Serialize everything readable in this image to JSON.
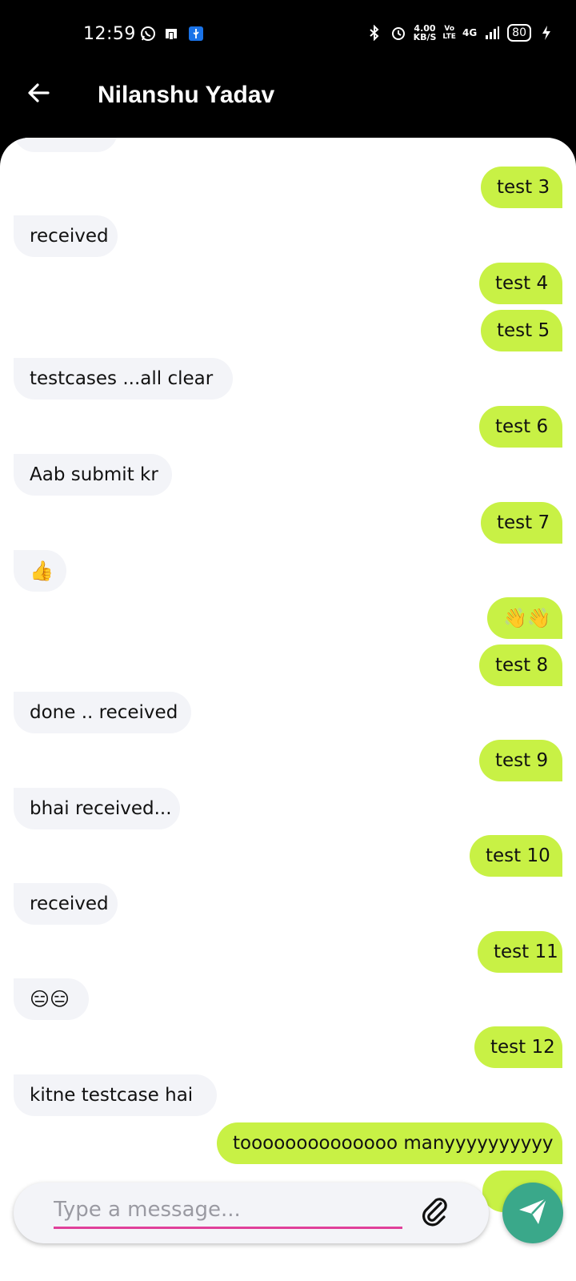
{
  "status": {
    "time": "12:59",
    "speed_value": "4.00",
    "speed_unit": "KB/S",
    "volte_top": "Vo",
    "volte_bottom": "LTE",
    "network": "4G",
    "battery": "80"
  },
  "header": {
    "title": "Nilanshu Yadav"
  },
  "messages": [
    {
      "dir": "out",
      "text": "test 3"
    },
    {
      "dir": "in",
      "text": "received"
    },
    {
      "dir": "out",
      "text": "test 4"
    },
    {
      "dir": "out",
      "text": "test 5"
    },
    {
      "dir": "in",
      "text": "testcases ...all clear"
    },
    {
      "dir": "out",
      "text": "test 6"
    },
    {
      "dir": "in",
      "text": "Aab submit kr"
    },
    {
      "dir": "out",
      "text": "test 7"
    },
    {
      "dir": "in",
      "text": "👍"
    },
    {
      "dir": "out",
      "text": "👋👋"
    },
    {
      "dir": "out",
      "text": "test 8"
    },
    {
      "dir": "in",
      "text": "done .. received"
    },
    {
      "dir": "out",
      "text": "test 9"
    },
    {
      "dir": "in",
      "text": "bhai received..."
    },
    {
      "dir": "out",
      "text": "test 10"
    },
    {
      "dir": "in",
      "text": "received"
    },
    {
      "dir": "out",
      "text": "test 11"
    },
    {
      "dir": "in",
      "text": "😑😑"
    },
    {
      "dir": "out",
      "text": "test 12"
    },
    {
      "dir": "in",
      "text": "kitne testcase hai"
    },
    {
      "dir": "out",
      "text": "toooooooooooooo manyyyyyyyyyy"
    }
  ],
  "composer": {
    "placeholder": "Type a message..."
  },
  "icons": {
    "back": "arrow-left-icon",
    "attach": "paperclip-icon",
    "send": "send-icon"
  },
  "colors": {
    "header_bg": "#000000",
    "incoming_bubble": "#f3f4f8",
    "outgoing_bubble": "#c8f145",
    "send_button": "#3aa88a",
    "input_underline": "#e0409a"
  }
}
